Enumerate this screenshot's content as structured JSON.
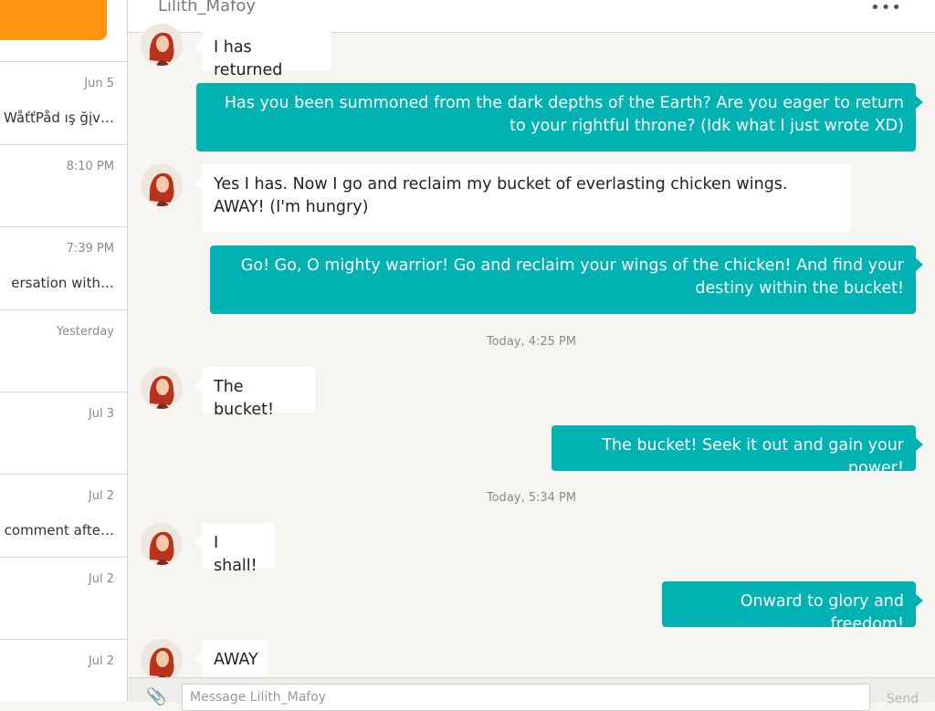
{
  "sidebar": {
    "conversations": [
      {
        "date": "Jun 5",
        "preview": "WåťťPåd ış ğįv…"
      },
      {
        "date": "8:10 PM",
        "preview": ""
      },
      {
        "date": "7:39 PM",
        "preview": "ersation with…"
      },
      {
        "date": "Yesterday",
        "preview": ""
      },
      {
        "date": "Jul 3",
        "preview": ""
      },
      {
        "date": "Jul 2",
        "preview": "comment afte…"
      },
      {
        "date": "Jul 2",
        "preview": ""
      },
      {
        "date": "Jul 2",
        "preview": ""
      }
    ]
  },
  "chat": {
    "title": "Lilith_Mafoy",
    "more_icon": "more-horizontal-icon",
    "messages": [
      {
        "from": "them",
        "text": "I has returned"
      },
      {
        "from": "me",
        "text": "Has you been summoned from the dark depths of the Earth? Are you eager to return to your rightful throne? (Idk what I just wrote XD)"
      },
      {
        "from": "them",
        "text": "Yes I has. Now I go and reclaim my bucket of everlasting chicken wings. AWAY! (I'm hungry)"
      },
      {
        "from": "me",
        "text": "Go! Go, O mighty warrior! Go and reclaim your wings of the chicken! And find your destiny within the bucket!"
      },
      {
        "timestamp": "Today, 4:25 PM"
      },
      {
        "from": "them",
        "text": "The bucket!"
      },
      {
        "from": "me",
        "text": "The bucket! Seek it out and gain your power!"
      },
      {
        "timestamp": "Today, 5:34 PM"
      },
      {
        "from": "them",
        "text": "I shall!"
      },
      {
        "from": "me",
        "text": "Onward to glory and freedom!"
      },
      {
        "from": "them",
        "text": "AWAY"
      }
    ]
  },
  "composer": {
    "placeholder": "Message Lilith_Mafoy",
    "send_label": "Send",
    "attach_icon": "paperclip-icon"
  },
  "colors": {
    "accent_orange": "#ff9410",
    "outgoing_bubble": "#00b2b2",
    "background": "#f6f5f2"
  }
}
